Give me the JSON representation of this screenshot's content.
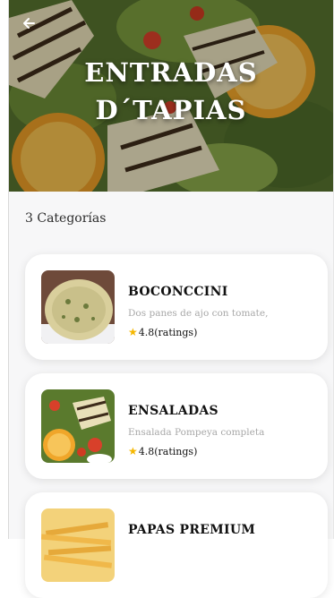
{
  "header": {
    "title_line1": "ENTRADAS",
    "title_line2": "D´TAPIAS",
    "back_icon": "arrow-left-icon"
  },
  "category_count": "3 Categorías",
  "items": [
    {
      "name": "BOCONCCINI",
      "description": "Dos panes de ajo con tomate,",
      "rating": "4.8(ratings)",
      "image": "garlic-bread-image"
    },
    {
      "name": "ENSALADAS",
      "description": "Ensalada Pompeya completa",
      "rating": "4.8(ratings)",
      "image": "salad-image"
    },
    {
      "name": "PAPAS PREMIUM",
      "description": "",
      "rating": "",
      "image": "fries-image"
    }
  ],
  "colors": {
    "star": "#f5b700",
    "card_bg": "#ffffff",
    "page_bg": "#f7f7f8"
  }
}
